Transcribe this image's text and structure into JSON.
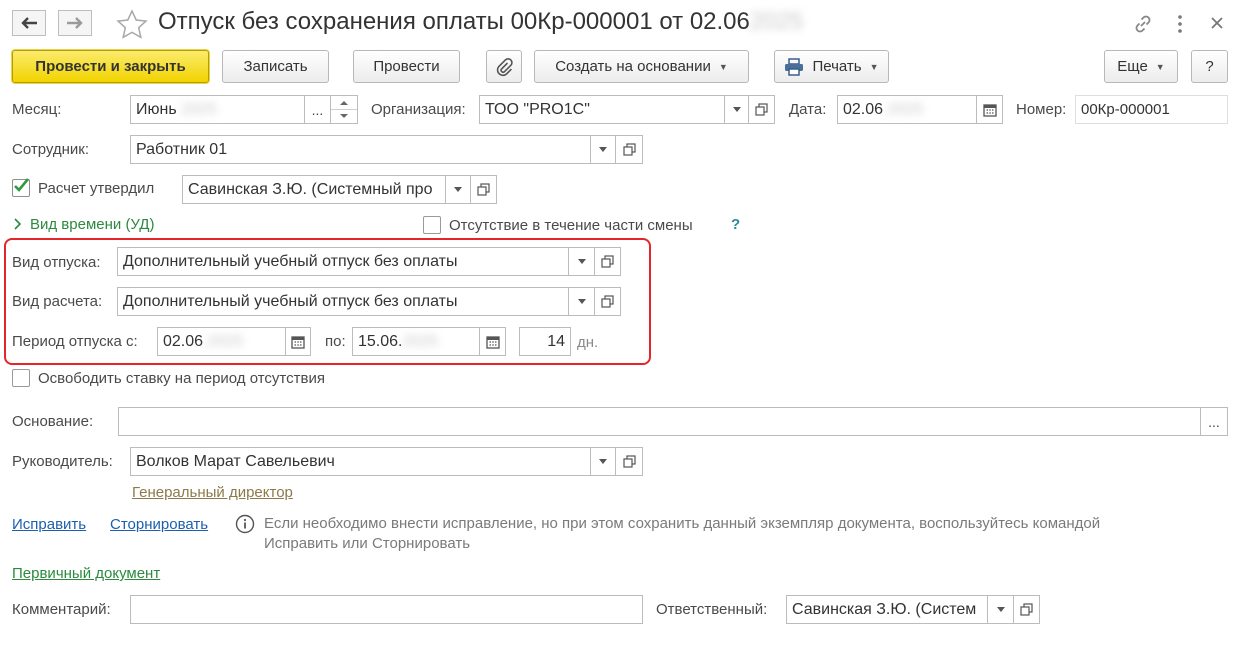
{
  "header": {
    "title": "Отпуск без сохранения оплаты 00Кр-000001 от 02.06",
    "title_hidden_year": "2025",
    "back_icon": "arrow-left-icon",
    "forward_icon": "arrow-right-icon",
    "favorite_icon": "star-icon",
    "link_icon": "link-icon",
    "menu_icon": "more-vertical-icon",
    "close_icon": "close-icon"
  },
  "toolbar": {
    "post_and_close": "Провести и закрыть",
    "save": "Записать",
    "post": "Провести",
    "create_based_on": "Создать на основании",
    "print": "Печать",
    "more": "Еще",
    "help": "?"
  },
  "form": {
    "month_label": "Месяц:",
    "month_value": "Июнь",
    "month_hidden": "2025",
    "month_select": "...",
    "org_label": "Организация:",
    "org_value": "ТОО \"PRO1C\"",
    "date_label": "Дата:",
    "date_value": "02.06",
    "date_hidden": ".2025",
    "number_label": "Номер:",
    "number_value": "00Кр-000001",
    "employee_label": "Сотрудник:",
    "employee_value": "Работник 01",
    "approved_label": "Расчет утвердил",
    "approved_checked": true,
    "approved_value": "Савинская З.Ю. (Системный про",
    "time_type_link": "Вид времени (УД)",
    "partial_shift_label": "Отсутствие в течение части смены",
    "partial_shift_help": "?",
    "vacation_type_label": "Вид отпуска:",
    "vacation_type_value": "Дополнительный учебный отпуск без оплаты",
    "calc_type_label": "Вид расчета:",
    "calc_type_value": "Дополнительный учебный отпуск без оплаты",
    "period_label": "Период отпуска с:",
    "period_from": "02.06",
    "period_from_hidden": ".2025",
    "period_to_label": "по:",
    "period_to": "15.06.",
    "period_to_hidden": "2025",
    "days_value": "14",
    "days_unit": "дн.",
    "release_rate_label": "Освободить ставку на период отсутствия",
    "basis_label": "Основание:",
    "basis_value": "",
    "basis_select": "...",
    "manager_label": "Руководитель:",
    "manager_value": "Волков Марат Савельевич",
    "manager_position": "Генеральный директор",
    "fix_link": "Исправить",
    "reverse_link": "Сторнировать",
    "info_text_1": "Если необходимо внести исправление, но при этом сохранить данный экземпляр документа, воспользуйтесь командой",
    "info_text_2": "Исправить или Сторнировать",
    "primary_doc_link": "Первичный документ",
    "comment_label": "Комментарий:",
    "comment_value": "",
    "responsible_label": "Ответственный:",
    "responsible_value": "Савинская З.Ю. (Систем"
  },
  "colors": {
    "primary_button": "#f1d400",
    "highlight_border": "#e4262b",
    "link": "#1d5fae",
    "green_link": "#2b8a3e",
    "checkmark": "#2e9a3f"
  }
}
